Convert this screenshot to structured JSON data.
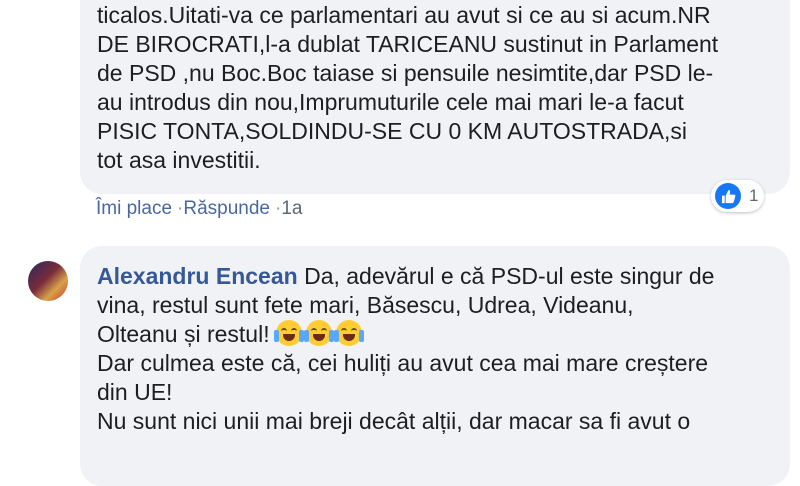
{
  "comments": [
    {
      "text": "ticalos.Uitati-va ce parlamentari au avut si ce au si acum.NR\nDE BIROCRATI,l-a dublat TARICEANU sustinut in Parlament\nde PSD ,nu Boc.Boc taiase si pensuile nesimtite,dar PSD le-\nau introdus din nou,Imprumuturile cele mai mari le-a facut\nPISIC TONTA,SOLDINDU-SE CU 0 KM AUTOSTRADA,si\ntot asa investitii.",
      "actions": {
        "like": "Îmi place",
        "reply": "Răspunde",
        "time": "1a"
      },
      "reaction_icon": "thumbs-up-icon",
      "reaction_count": "1"
    },
    {
      "author": "Alexandru Encean",
      "text_line1": "Da, adevărul e că PSD-ul este singur de\nvina, restul sunt fete mari, Băsescu, Udrea, Videanu,\nOlteanu și restul! ",
      "emoji": "tears-of-joy-icon",
      "emoji_count": 3,
      "text_rest": "\nDar culmea este că, cei huliți au avut cea mai mare creștere\ndin UE!\nNu sunt nici unii mai breji decât alții, dar macar sa fi avut o"
    }
  ],
  "colors": {
    "bubble": "#f0f2f5",
    "author": "#365899",
    "like": "#1877f2"
  }
}
